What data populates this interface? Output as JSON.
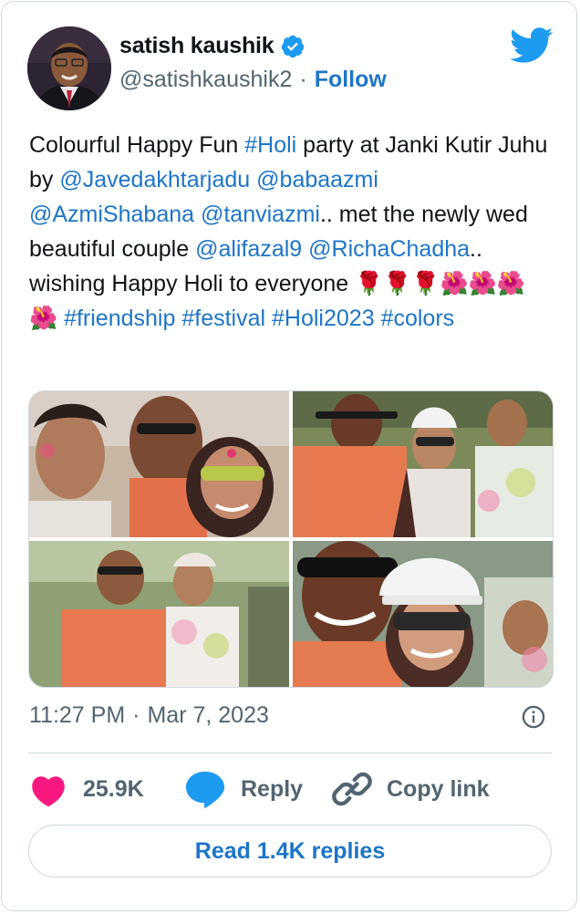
{
  "author": {
    "name": "satish kaushik",
    "handle": "@satishkaushik2",
    "separator": "·",
    "follow_label": "Follow"
  },
  "tweet": {
    "segments": [
      {
        "t": "text",
        "v": "Colourful Happy Fun "
      },
      {
        "t": "tag",
        "v": "#Holi"
      },
      {
        "t": "text",
        "v": " party at Janki Kutir Juhu by "
      },
      {
        "t": "tag",
        "v": "@Javedakhtarjadu"
      },
      {
        "t": "text",
        "v": " "
      },
      {
        "t": "tag",
        "v": "@babaazmi"
      },
      {
        "t": "text",
        "v": " "
      },
      {
        "t": "tag",
        "v": "@AzmiShabana"
      },
      {
        "t": "text",
        "v": " "
      },
      {
        "t": "tag",
        "v": "@tanviazmi"
      },
      {
        "t": "text",
        "v": ".. met the newly wed beautiful couple "
      },
      {
        "t": "tag",
        "v": "@alifazal9"
      },
      {
        "t": "text",
        "v": " "
      },
      {
        "t": "tag",
        "v": "@RichaChadha"
      },
      {
        "t": "text",
        "v": ".. wishing Happy Holi to everyone 🌹🌹🌹🌺🌺🌺🌺 "
      },
      {
        "t": "tag",
        "v": "#friendship"
      },
      {
        "t": "text",
        "v": " "
      },
      {
        "t": "tag",
        "v": "#festival"
      },
      {
        "t": "text",
        "v": " "
      },
      {
        "t": "tag",
        "v": "#Holi2023"
      },
      {
        "t": "text",
        "v": " "
      },
      {
        "t": "tag",
        "v": "#colors"
      }
    ]
  },
  "meta": {
    "time": "11:27 PM",
    "separator": "·",
    "date": "Mar 7, 2023"
  },
  "actions": {
    "likes": "25.9K",
    "reply_label": "Reply",
    "copy_label": "Copy link"
  },
  "read_replies_label": "Read 1.4K replies",
  "colors": {
    "accent": "#1d75c8",
    "like": "#f91880",
    "muted": "#536471",
    "border": "#cfd9de"
  },
  "icons": [
    "verified-icon",
    "twitter-bird-icon",
    "info-icon",
    "heart-icon",
    "reply-icon",
    "link-icon"
  ]
}
